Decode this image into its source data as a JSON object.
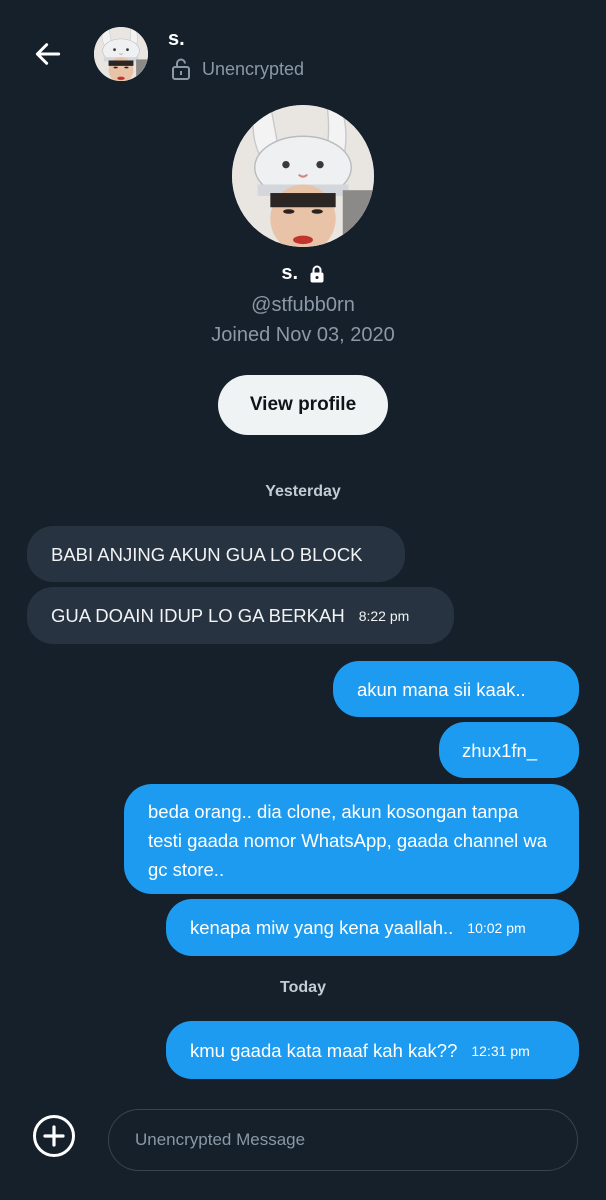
{
  "header": {
    "back_icon": "arrow-left-icon",
    "name": "s.",
    "status_icon": "unlocked-padlock-icon",
    "status": "Unencrypted"
  },
  "profile": {
    "name": "s.",
    "protected_icon": "lock-icon",
    "handle": "@stfubb0rn",
    "joined": "Joined Nov 03, 2020",
    "view_profile_label": "View profile"
  },
  "conversation": {
    "sections": [
      {
        "day": "Yesterday",
        "messages": [
          {
            "direction": "incoming",
            "text": "BABI ANJING AKUN GUA LO BLOCK",
            "time": ""
          },
          {
            "direction": "incoming",
            "text": "GUA DOAIN IDUP LO GA BERKAH",
            "time": "8:22 pm"
          },
          {
            "direction": "outgoing",
            "text": "akun mana sii kaak..",
            "time": ""
          },
          {
            "direction": "outgoing",
            "text": "zhux1fn_",
            "time": ""
          },
          {
            "direction": "outgoing",
            "text": "beda orang.. dia clone, akun kosongan tanpa testi gaada nomor WhatsApp, gaada channel wa gc store..",
            "time": ""
          },
          {
            "direction": "outgoing",
            "text": "kenapa miw yang kena yaallah..",
            "time": "10:02 pm"
          }
        ]
      },
      {
        "day": "Today",
        "messages": [
          {
            "direction": "outgoing",
            "text": "kmu gaada kata maaf kah kak??",
            "time": "12:31 pm"
          }
        ]
      }
    ]
  },
  "composer": {
    "add_icon": "plus-circle-icon",
    "placeholder": "Unencrypted Message"
  },
  "colors": {
    "background": "#15202b",
    "incoming_bubble": "#273340",
    "outgoing_bubble": "#1d9bf0",
    "secondary_text": "#8b98a5"
  }
}
